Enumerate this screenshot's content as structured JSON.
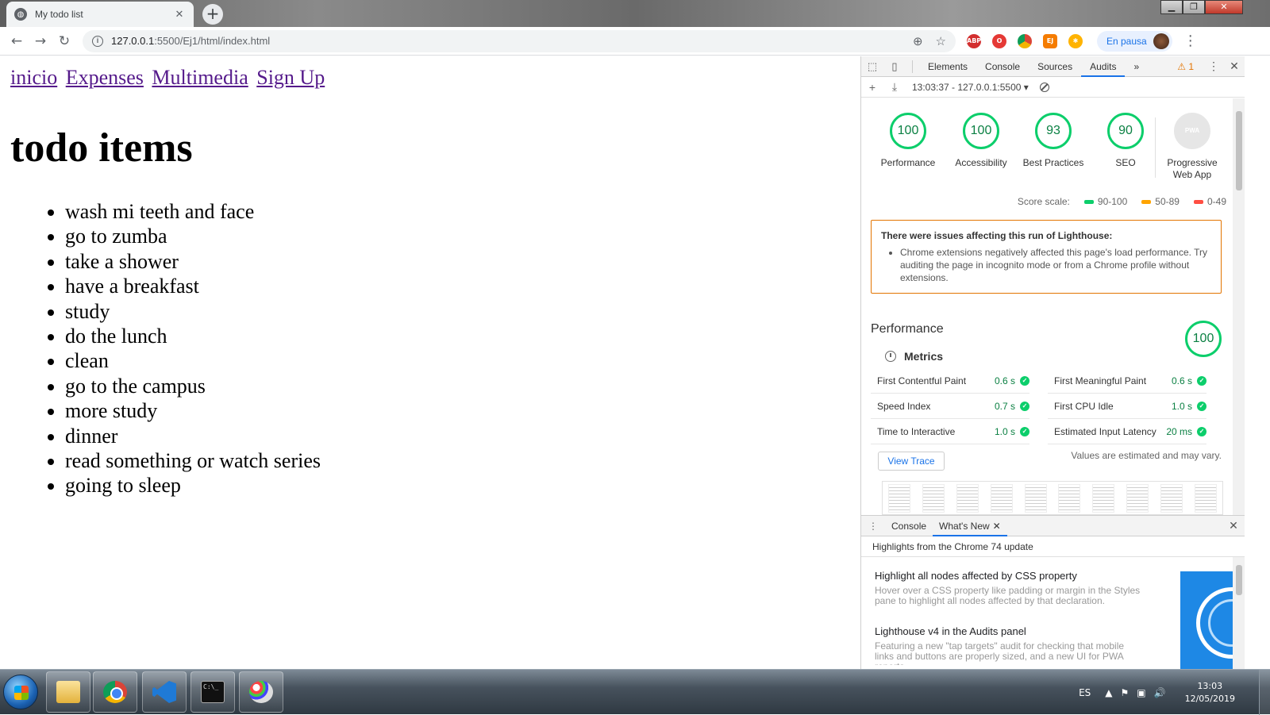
{
  "browser": {
    "tab_title": "My todo list",
    "tab_favicon": "globe-icon",
    "url_host": "127.0.0.1",
    "url_path": ":5500/Ej1/html/index.html",
    "profile_label": "En pausa",
    "extensions": [
      "ABP",
      "Opera",
      "Chrome",
      "EJ",
      "Settings"
    ]
  },
  "page": {
    "nav": [
      "inicio",
      "Expenses",
      "Multimedia",
      "Sign Up"
    ],
    "heading": "todo items",
    "items": [
      "wash mi teeth and face",
      "go to zumba",
      "take a shower",
      "have a breakfast",
      "study",
      "do the lunch",
      "clean",
      "go to the campus",
      "more study",
      "dinner",
      "read something or watch series",
      "going to sleep"
    ]
  },
  "devtools": {
    "tabs": [
      "Elements",
      "Console",
      "Sources",
      "Audits"
    ],
    "active_tab": "Audits",
    "more_tabs": "»",
    "warnings": "1",
    "run_selector": "13:03:37 - 127.0.0.1:5500",
    "gauges": [
      {
        "label": "Performance",
        "score": "100"
      },
      {
        "label": "Accessibility",
        "score": "100"
      },
      {
        "label": "Best Practices",
        "score": "93"
      },
      {
        "label": "SEO",
        "score": "90"
      }
    ],
    "pwa": {
      "badge": "PWA",
      "label_1": "Progressive",
      "label_2": "Web App"
    },
    "score_scale": {
      "label": "Score scale:",
      "ranges": [
        {
          "text": "90-100",
          "color": "#0cce6b"
        },
        {
          "text": "50-89",
          "color": "#ffa400"
        },
        {
          "text": "0-49",
          "color": "#ff4e42"
        }
      ]
    },
    "alert": {
      "title": "There were issues affecting this run of Lighthouse:",
      "item": "Chrome extensions negatively affected this page's load performance. Try auditing the page in incognito mode or from a Chrome profile without extensions."
    },
    "performance": {
      "title": "Performance",
      "score": "100",
      "metrics_title": "Metrics",
      "metrics": [
        [
          {
            "name": "First Contentful Paint",
            "value": "0.6 s"
          },
          {
            "name": "First Meaningful Paint",
            "value": "0.6 s"
          }
        ],
        [
          {
            "name": "Speed Index",
            "value": "0.7 s"
          },
          {
            "name": "First CPU Idle",
            "value": "1.0 s"
          }
        ],
        [
          {
            "name": "Time to Interactive",
            "value": "1.0 s"
          },
          {
            "name": "Estimated Input Latency",
            "value": "20 ms"
          }
        ]
      ],
      "view_trace": "View Trace",
      "estimated_note": "Values are estimated and may vary."
    },
    "drawer": {
      "tabs": [
        "Console",
        "What's New"
      ],
      "active_tab": "What's New",
      "highlights": "Highlights from the Chrome 74 update",
      "items": [
        {
          "title": "Highlight all nodes affected by CSS property",
          "desc": "Hover over a CSS property like padding or margin in the Styles pane to highlight all nodes affected by that declaration."
        },
        {
          "title": "Lighthouse v4 in the Audits panel",
          "desc": "Featuring a new \"tap targets\" audit for checking that mobile links and buttons are properly sized, and a new UI for PWA reports."
        }
      ]
    }
  },
  "taskbar": {
    "apps": [
      "explorer-icon",
      "chrome-icon",
      "vscode-icon",
      "cmd-icon",
      "paint-icon"
    ],
    "lang": "ES",
    "time": "13:03",
    "date": "12/05/2019"
  }
}
